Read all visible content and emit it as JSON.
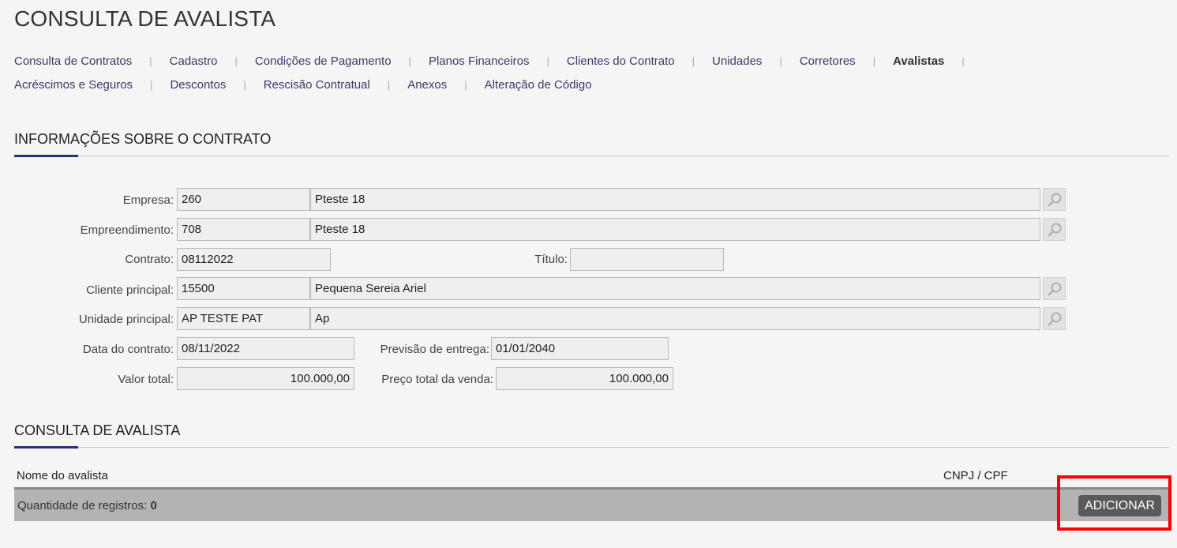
{
  "page": {
    "title": "CONSULTA DE AVALISTA"
  },
  "nav": {
    "row1": [
      {
        "label": "Consulta de Contratos"
      },
      {
        "label": "Cadastro"
      },
      {
        "label": "Condições de Pagamento"
      },
      {
        "label": "Planos Financeiros"
      },
      {
        "label": "Clientes do Contrato"
      },
      {
        "label": "Unidades"
      },
      {
        "label": "Corretores"
      },
      {
        "label": "Avalistas",
        "active": true
      }
    ],
    "row2": [
      {
        "label": "Acréscimos e Seguros"
      },
      {
        "label": "Descontos"
      },
      {
        "label": "Rescisão Contratual"
      },
      {
        "label": "Anexos"
      },
      {
        "label": "Alteração de Código"
      }
    ]
  },
  "contract_section": {
    "title": "INFORMAÇÕES SOBRE O CONTRATO",
    "empresa": {
      "label": "Empresa:",
      "code": "260",
      "name": "Pteste 18"
    },
    "empreendimento": {
      "label": "Empreendimento:",
      "code": "708",
      "name": "Pteste 18"
    },
    "contrato": {
      "label": "Contrato:",
      "value": "08112022"
    },
    "titulo": {
      "label": "Título:",
      "value": ""
    },
    "cliente_principal": {
      "label": "Cliente principal:",
      "code": "15500",
      "name": "Pequena Sereia Ariel"
    },
    "unidade_principal": {
      "label": "Unidade principal:",
      "code": "AP TESTE PAT",
      "name": "Ap"
    },
    "data_contrato": {
      "label": "Data do contrato:",
      "value": "08/11/2022"
    },
    "previsao_entrega": {
      "label": "Previsão de entrega:",
      "value": "01/01/2040"
    },
    "valor_total": {
      "label": "Valor total:",
      "value": "100.000,00"
    },
    "preco_total_venda": {
      "label": "Preço total da venda:",
      "value": "100.000,00"
    }
  },
  "avalista_section": {
    "title": "CONSULTA DE AVALISTA",
    "columns": {
      "nome": "Nome do avalista",
      "cnpj": "CNPJ / CPF"
    },
    "footer": {
      "count_label": "Quantidade de registros:",
      "count_value": "0"
    },
    "add_button": "ADICIONAR"
  }
}
